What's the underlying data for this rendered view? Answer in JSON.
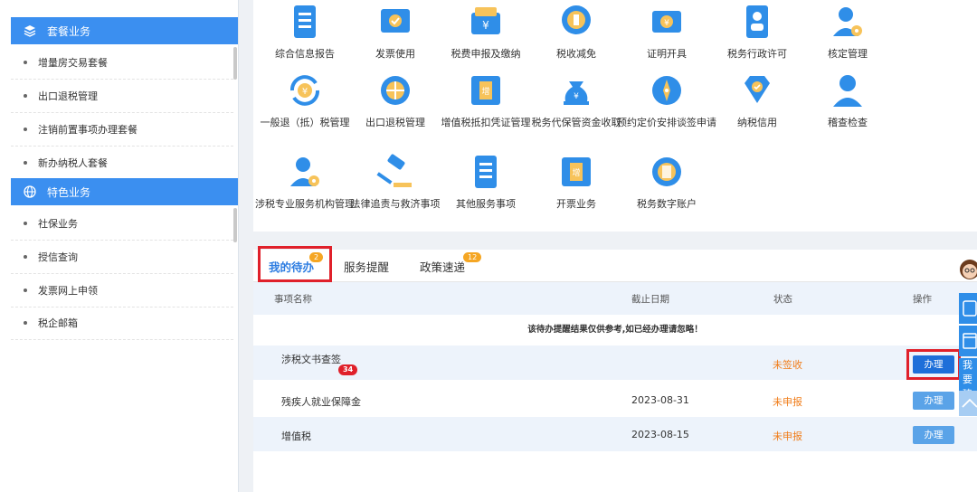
{
  "sidebar": {
    "sections": [
      {
        "title": "套餐业务",
        "icon": "layers-icon",
        "items": [
          "增量房交易套餐",
          "出口退税管理",
          "注销前置事项办理套餐",
          "新办纳税人套餐"
        ]
      },
      {
        "title": "特色业务",
        "icon": "globe-icon",
        "items": [
          "社保业务",
          "授信查询",
          "发票网上申领",
          "税企邮箱"
        ]
      }
    ]
  },
  "services": [
    {
      "label": "综合信息报告",
      "icon": "report-icon"
    },
    {
      "label": "发票使用",
      "icon": "invoice-icon"
    },
    {
      "label": "税费申报及缴纳",
      "icon": "tax-payment-icon"
    },
    {
      "label": "税收减免",
      "icon": "tax-reduction-icon"
    },
    {
      "label": "证明开具",
      "icon": "certificate-icon"
    },
    {
      "label": "税务行政许可",
      "icon": "permit-icon"
    },
    {
      "label": "核定管理",
      "icon": "user-gear-icon"
    },
    {
      "label": "一般退（抵）税管理",
      "icon": "refund-icon"
    },
    {
      "label": "出口退税管理",
      "icon": "export-globe-icon"
    },
    {
      "label": "增值税抵扣凭证管理",
      "icon": "vat-ticket-icon"
    },
    {
      "label": "税务代保管资金收取",
      "icon": "money-bag-icon"
    },
    {
      "label": "预约定价安排谈签申请",
      "icon": "compass-icon"
    },
    {
      "label": "纳税信用",
      "icon": "diamond-check-icon"
    },
    {
      "label": "稽查检查",
      "icon": "inspector-icon"
    },
    {
      "label": "涉税专业服务机构管理",
      "icon": "agency-gear-icon"
    },
    {
      "label": "法律追责与救济事项",
      "icon": "gavel-icon"
    },
    {
      "label": "其他服务事项",
      "icon": "list-doc-icon"
    },
    {
      "label": "开票业务",
      "icon": "vat-ticket-icon"
    },
    {
      "label": "税务数字账户",
      "icon": "coins-icon"
    }
  ],
  "tabs": [
    {
      "label": "我的待办",
      "badge": "2"
    },
    {
      "label": "服务提醒",
      "badge": ""
    },
    {
      "label": "政策速递",
      "badge": "12"
    }
  ],
  "table": {
    "headers": [
      "事项名称",
      "截止日期",
      "状态",
      "操作"
    ],
    "notice": "该待办提醒结果仅供参考,如已经办理请忽略！",
    "rows": [
      {
        "name": "涉税文书查签",
        "badge": "34",
        "date": "",
        "status": "未签收",
        "action": "办理"
      },
      {
        "name": "残疾人就业保障金",
        "badge": "",
        "date": "2023-08-31",
        "status": "未申报",
        "action": "办理"
      },
      {
        "name": "增值税",
        "badge": "",
        "date": "2023-08-15",
        "status": "未申报",
        "action": "办理"
      }
    ]
  },
  "float_panel": {
    "label": "我要建议"
  },
  "colors": {
    "accent": "#3b8ff0",
    "status": "#f07d1a",
    "highlight": "#e0202a",
    "primary_button": "#1e6fd9"
  }
}
